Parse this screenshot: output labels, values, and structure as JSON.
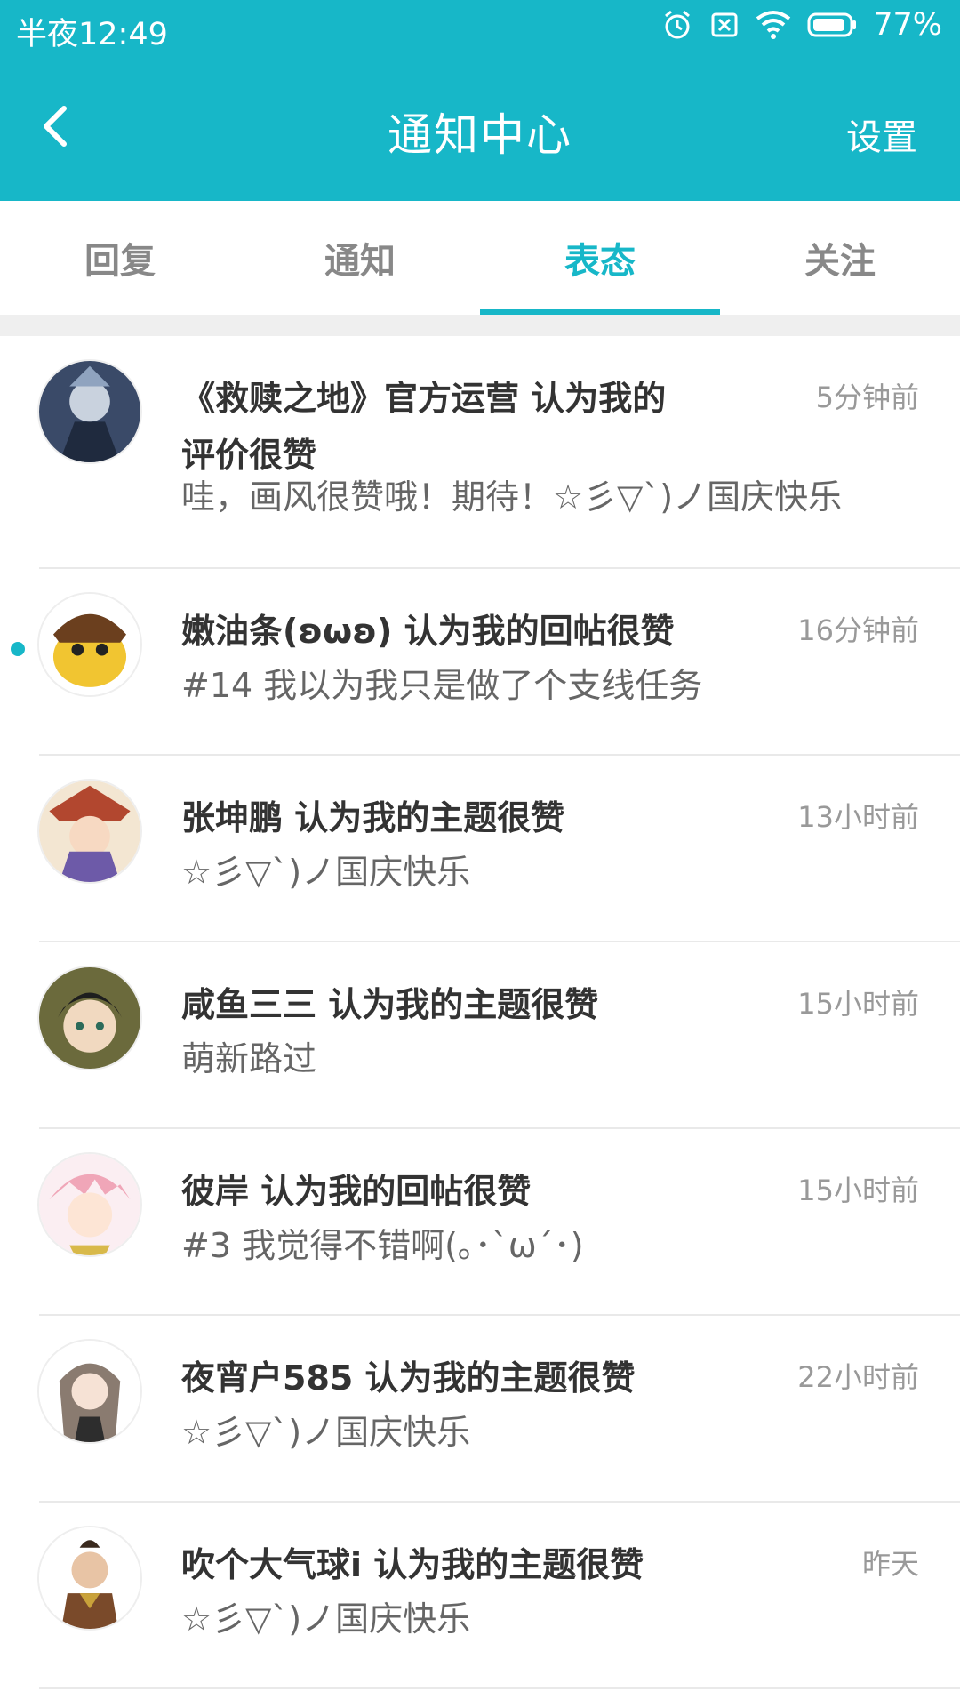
{
  "status_bar": {
    "time": "半夜12:49",
    "battery": "77%"
  },
  "header": {
    "title": "通知中心",
    "settings_label": "设置"
  },
  "tabs": [
    {
      "label": "回复",
      "active": false
    },
    {
      "label": "通知",
      "active": false
    },
    {
      "label": "表态",
      "active": true
    },
    {
      "label": "关注",
      "active": false
    }
  ],
  "colors": {
    "accent": "#17b7c8",
    "unread_dot": "#17b7c8"
  },
  "notifications": [
    {
      "user": "《救赎之地》官方运营",
      "action": "认为我的评价很赞",
      "headline": "《救赎之地》官方运营 认为我的评价很赞",
      "time": "5分钟前",
      "content": "哇，画风很赞哦！期待！☆彡▽`)ノ国庆快乐",
      "unread": false
    },
    {
      "user": "嫩油条(ʚωʚ)",
      "action": "认为我的回帖很赞",
      "headline": "嫩油条(ʚωʚ) 认为我的回帖很赞",
      "time": "16分钟前",
      "content": "#14 我以为我只是做了个支线任务",
      "unread": true
    },
    {
      "user": "张坤鹏",
      "action": "认为我的主题很赞",
      "headline": "张坤鹏 认为我的主题很赞",
      "time": "13小时前",
      "content": "☆彡▽`)ノ国庆快乐",
      "unread": false
    },
    {
      "user": "咸鱼三三",
      "action": "认为我的主题很赞",
      "headline": "咸鱼三三 认为我的主题很赞",
      "time": "15小时前",
      "content": "萌新路过",
      "unread": false
    },
    {
      "user": "彼岸",
      "action": "认为我的回帖很赞",
      "headline": "彼岸 认为我的回帖很赞",
      "time": "15小时前",
      "content": "#3 我觉得不错啊(｡･`ω´･)",
      "unread": false
    },
    {
      "user": "夜宵户585",
      "action": "认为我的主题很赞",
      "headline": "夜宵户585 认为我的主题很赞",
      "time": "22小时前",
      "content": "☆彡▽`)ノ国庆快乐",
      "unread": false
    },
    {
      "user": "吹个大气球i",
      "action": "认为我的主题很赞",
      "headline": "吹个大气球i 认为我的主题很赞",
      "time": "昨天",
      "content": "☆彡▽`)ノ国庆快乐",
      "unread": false
    }
  ]
}
